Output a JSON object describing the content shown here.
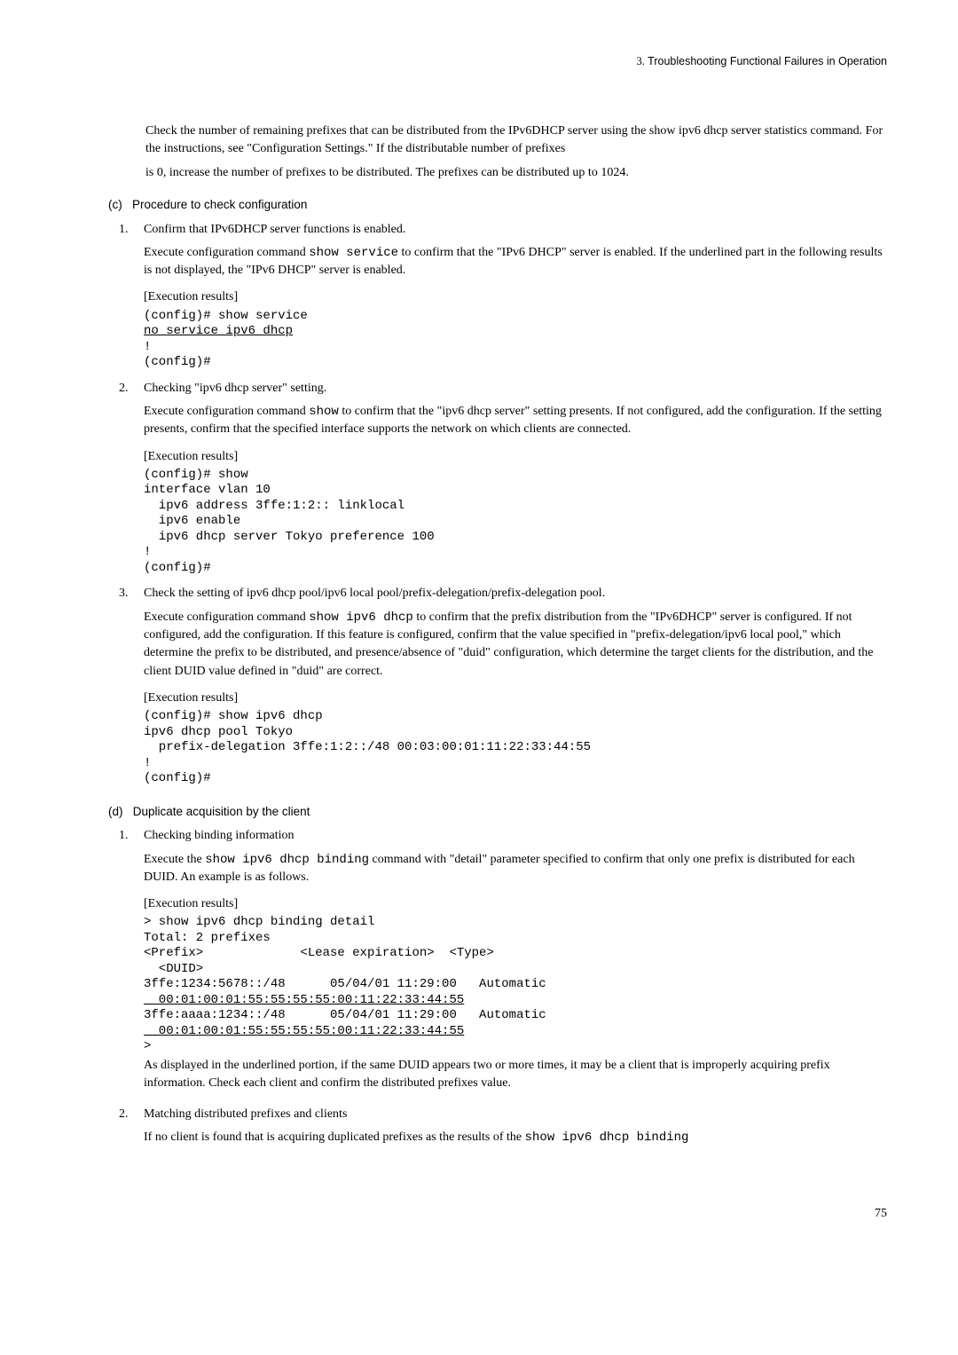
{
  "header": {
    "num": "3.",
    "title": "Troubleshooting Functional Failures in Operation"
  },
  "intro": {
    "p1": "Check the number of remaining prefixes that can be distributed from the IPv6DHCP server using the show ipv6 dhcp server statistics command. For the instructions, see \"Configuration Settings.\" If the distributable number of prefixes",
    "p2": "is 0, increase the number of prefixes to be distributed. The prefixes can be distributed up to 1024."
  },
  "sec_c": {
    "label": "(c)",
    "title": "Procedure to check configuration"
  },
  "item1": {
    "num": "1.",
    "title": "Confirm that IPv6DHCP server functions is enabled.",
    "desc_a": "Execute configuration command ",
    "code_inline": "show service",
    "desc_b": " to confirm that the \"IPv6 DHCP\" server is enabled. If the underlined part in the following results is not displayed, the \"IPv6 DHCP\" server is enabled.",
    "exec": "[Execution results]",
    "code_l1": "(config)# show service",
    "code_ul": "no service ipv6 dhcp",
    "code_l3": "!",
    "code_l4": "(config)#"
  },
  "item2": {
    "num": "2.",
    "title": "Checking \"ipv6 dhcp server\" setting.",
    "desc_a": "Execute configuration command ",
    "code_inline": "show",
    "desc_b": " to confirm that the \"ipv6 dhcp server\" setting presents. If not configured, add the configuration. If the setting presents, confirm that the specified interface supports the network on which clients are connected.",
    "exec": "[Execution results]",
    "code": "(config)# show\ninterface vlan 10\n  ipv6 address 3ffe:1:2:: linklocal\n  ipv6 enable\n  ipv6 dhcp server Tokyo preference 100\n!\n(config)#"
  },
  "item3": {
    "num": "3.",
    "title": "Check the setting of ipv6 dhcp pool/ipv6 local pool/prefix-delegation/prefix-delegation pool.",
    "desc_a": "Execute configuration command ",
    "code_inline": "show ipv6 dhcp",
    "desc_b": " to confirm that the prefix distribution from the \"IPv6DHCP\" server is configured. If not configured, add the configuration. If this feature is configured, confirm that the value specified in \"prefix-delegation/ipv6 local pool,\" which determine the prefix to be distributed, and presence/absence of \"duid\" configuration, which determine the target clients for the distribution, and the client DUID value defined in \"duid\" are correct.",
    "exec": "[Execution results]",
    "code": "(config)# show ipv6 dhcp\nipv6 dhcp pool Tokyo\n  prefix-delegation 3ffe:1:2::/48 00:03:00:01:11:22:33:44:55\n!\n(config)#"
  },
  "sec_d": {
    "label": "(d)",
    "title": "Duplicate acquisition by the client"
  },
  "item_d1": {
    "num": "1.",
    "title": "Checking binding information",
    "desc_a": "Execute the ",
    "code_inline": "show ipv6 dhcp binding",
    "desc_b": " command with \"detail\" parameter specified to confirm that only one prefix is distributed for each DUID. An example is as follows.",
    "exec": "[Execution results]",
    "code_l1": "> show ipv6 dhcp binding detail",
    "code_l2": "Total: 2 prefixes",
    "code_l3": "<Prefix>             <Lease expiration>  <Type>",
    "code_l4": "  <DUID>",
    "code_l5": "3ffe:1234:5678::/48      05/04/01 11:29:00   Automatic",
    "code_ul1": "  00:01:00:01:55:55:55:55:00:11:22:33:44:55",
    "code_l7": "3ffe:aaaa:1234::/48      05/04/01 11:29:00   Automatic",
    "code_ul2": "  00:01:00:01:55:55:55:55:00:11:22:33:44:55",
    "code_l9": ">",
    "tail": "As displayed in the underlined portion, if the same DUID appears two or more times, it may be a client that is improperly acquiring prefix information. Check each client and confirm the distributed prefixes value."
  },
  "item_d2": {
    "num": "2.",
    "title": "Matching distributed prefixes and clients",
    "desc_a": "If no client is found that is acquiring duplicated prefixes as the results of the ",
    "code_inline": "show ipv6 dhcp binding"
  },
  "page_number": "75"
}
